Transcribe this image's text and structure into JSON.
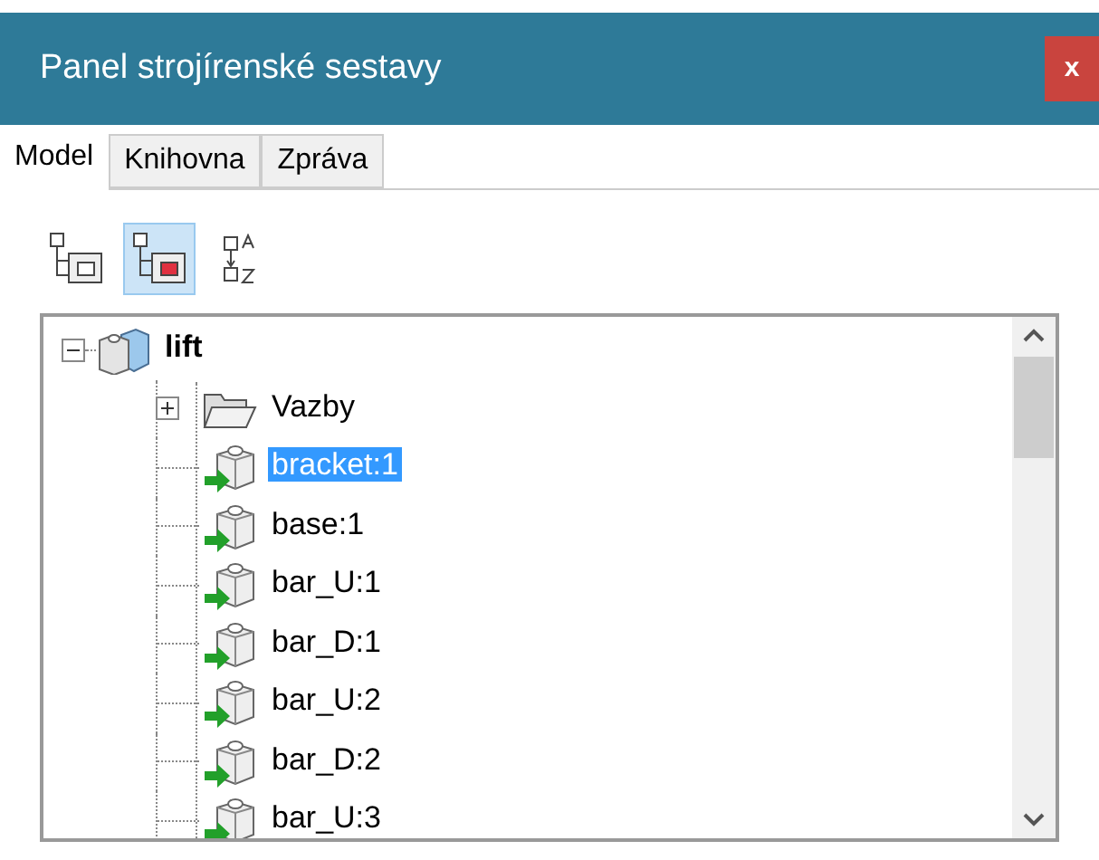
{
  "window": {
    "title": "Panel strojírenské sestavy",
    "close": "x"
  },
  "tabs": [
    {
      "label": "Model",
      "selected": true
    },
    {
      "label": "Knihovna",
      "selected": false
    },
    {
      "label": "Zpráva",
      "selected": false
    }
  ],
  "toolbar": [
    {
      "kind": "tree",
      "selected": false
    },
    {
      "kind": "tree-red",
      "selected": true
    },
    {
      "kind": "sort",
      "selected": false
    }
  ],
  "tree": {
    "label": "lift",
    "expanded": true,
    "selected": false,
    "children": [
      {
        "label": "Vazby",
        "kind": "folder",
        "expanded": false,
        "selected": false
      },
      {
        "label": "bracket:1",
        "kind": "part",
        "selected": true
      },
      {
        "label": "base:1",
        "kind": "part",
        "selected": false
      },
      {
        "label": "bar_U:1",
        "kind": "part",
        "selected": false
      },
      {
        "label": "bar_D:1",
        "kind": "part",
        "selected": false
      },
      {
        "label": "bar_U:2",
        "kind": "part",
        "selected": false
      },
      {
        "label": "bar_D:2",
        "kind": "part",
        "selected": false
      },
      {
        "label": "bar_U:3",
        "kind": "part",
        "selected": false
      }
    ]
  }
}
